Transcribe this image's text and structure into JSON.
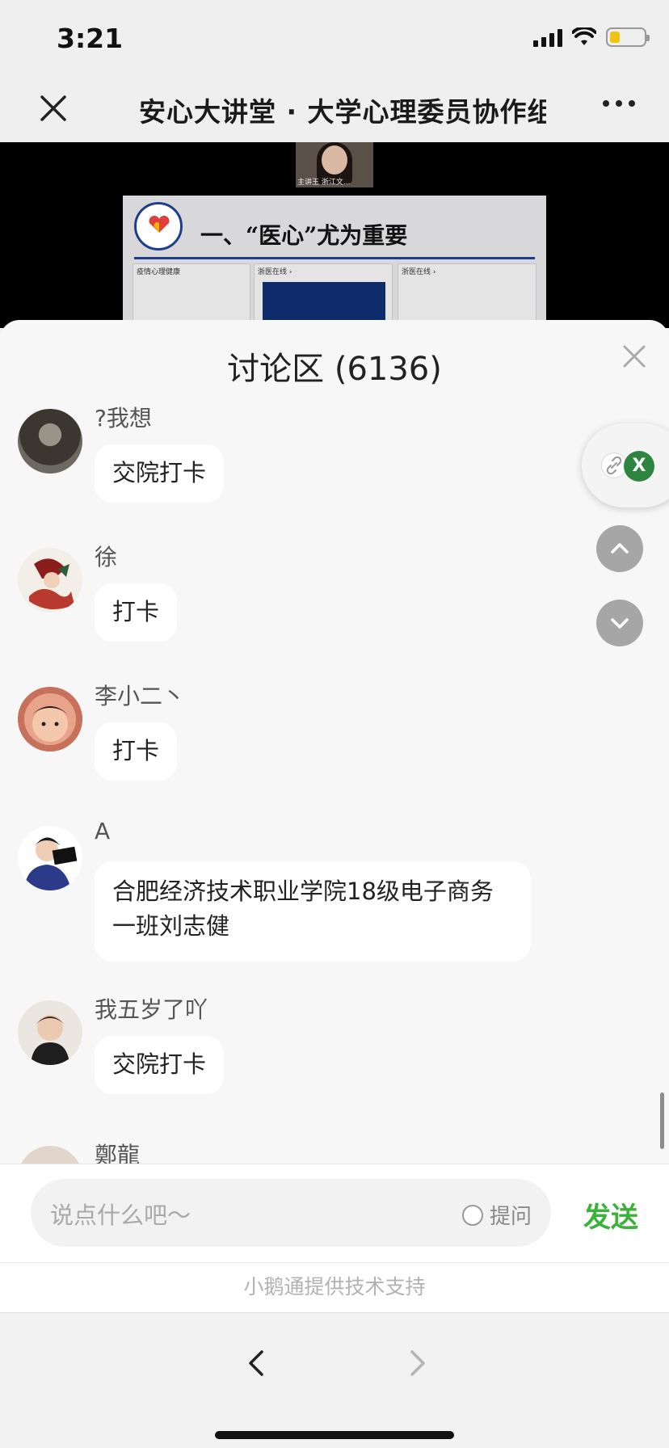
{
  "status_bar": {
    "time": "3:21"
  },
  "nav": {
    "title": "安心大讲堂 · 大学心理委员协作组"
  },
  "video": {
    "speaker_label": "主讲王 浙江文...",
    "slide_title": "一、“医心”尤为重要",
    "panel_labels": [
      "疫情心理健康",
      "浙医在线 ›",
      "浙医在线 ›"
    ]
  },
  "discussion": {
    "title": "讨论区 (6136)",
    "messages": [
      {
        "nickname": "?我想",
        "text": "交院打卡"
      },
      {
        "nickname": "徐",
        "text": "打卡"
      },
      {
        "nickname": "李小二丶",
        "text": "打卡"
      },
      {
        "nickname": "A",
        "text": "合肥经济技术职业学院18级电子商务一班刘志健"
      },
      {
        "nickname": "我五岁了吖",
        "text": "交院打卡"
      },
      {
        "nickname": "鄭龍",
        "text": ""
      }
    ]
  },
  "float": {
    "x_label": "X"
  },
  "input": {
    "placeholder": "说点什么吧～",
    "ask_label": "提问",
    "send_label": "发送"
  },
  "footer": {
    "support_text": "小鹅通提供技术支持"
  }
}
